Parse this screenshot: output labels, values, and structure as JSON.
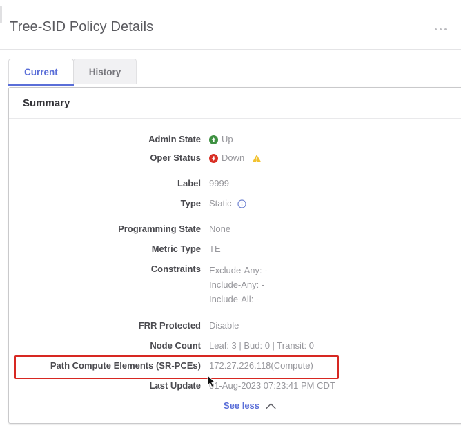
{
  "header": {
    "title": "Tree-SID Policy Details",
    "menu_icon": "kebab-menu-icon"
  },
  "tabs": [
    {
      "label": "Current",
      "active": true
    },
    {
      "label": "History",
      "active": false
    }
  ],
  "card": {
    "title": "Summary",
    "collapse_icon": "chevron-up-icon"
  },
  "details": [
    {
      "label": "Admin State",
      "value": "Up",
      "icon": "arrow-up-circle-green-icon"
    },
    {
      "label": "Oper Status",
      "value": "Down",
      "icon": "arrow-down-circle-red-icon",
      "warning_icon": "warning-triangle-icon"
    },
    {
      "label": "Label",
      "value": "9999"
    },
    {
      "label": "Type",
      "value": "Static",
      "info_icon": "info-circle-icon"
    },
    {
      "label": "Programming State",
      "value": "None"
    },
    {
      "label": "Metric Type",
      "value": "TE"
    },
    {
      "label": "Constraints",
      "lines": [
        "Exclude-Any: -",
        "Include-Any: -",
        "Include-All: -"
      ]
    },
    {
      "label": "FRR Protected",
      "value": "Disable"
    },
    {
      "label": "Node Count",
      "value": "Leaf: 3 | Bud: 0 | Transit: 0"
    },
    {
      "label": "Path Compute Elements (SR-PCEs)",
      "value": "172.27.226.118(Compute)",
      "highlighted": true
    },
    {
      "label": "Last Update",
      "value": "01-Aug-2023 07:23:41 PM CDT"
    }
  ],
  "footer": {
    "see_less_label": "See less",
    "see_less_icon": "chevron-up-icon"
  },
  "colors": {
    "accent_blue": "#5a6ed8",
    "status_up_green": "#3f9142",
    "status_down_red": "#d93025",
    "warning_amber": "#f2c230",
    "highlight_red": "#d72822",
    "label_gray": "#4b4b50",
    "value_gray": "#97979c"
  }
}
